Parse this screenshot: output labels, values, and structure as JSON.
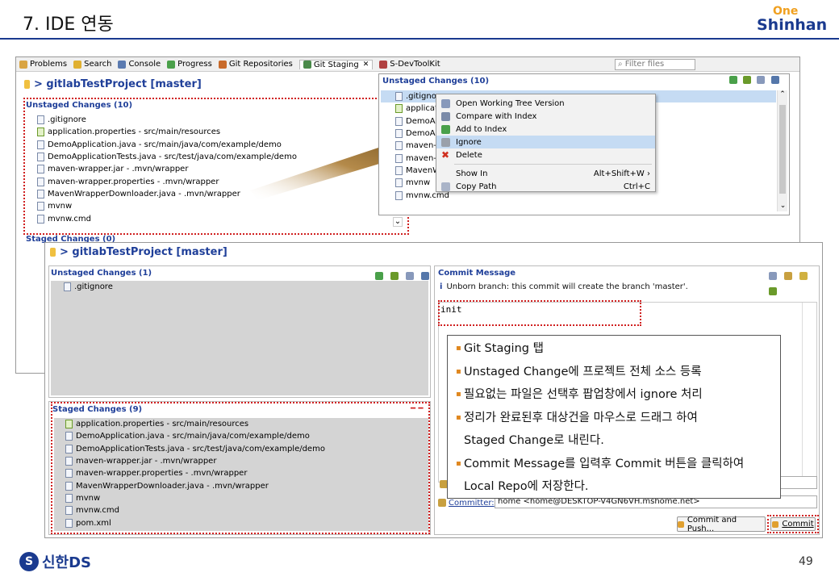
{
  "slide": {
    "title": "7. IDE 연동",
    "logo_top": "One",
    "logo_bottom": "Shinhan",
    "page_number": "49",
    "footer_brand": "신한DS",
    "footer_mark": "S"
  },
  "eclipse": {
    "tabs": [
      {
        "label": "Problems",
        "icon": "problems-icon"
      },
      {
        "label": "Search",
        "icon": "search-icon"
      },
      {
        "label": "Console",
        "icon": "console-icon"
      },
      {
        "label": "Progress",
        "icon": "progress-icon"
      },
      {
        "label": "Git Repositories",
        "icon": "git-repositories-icon"
      },
      {
        "label": "Git Staging",
        "icon": "git-staging-icon",
        "active": true
      },
      {
        "label": "S-DevToolKit",
        "icon": "devtoolkit-icon"
      }
    ],
    "filter_placeholder": "Filter files",
    "project_header": "> gitlabTestProject [master]",
    "unstaged_header": "Unstaged Changes (10)",
    "staged_header": "Staged Changes (0)",
    "unstaged_files": [
      ".gitignore",
      "application.properties - src/main/resources",
      "DemoApplication.java - src/main/java/com/example/demo",
      "DemoApplicationTests.java - src/test/java/com/example/demo",
      "maven-wrapper.jar - .mvn/wrapper",
      "maven-wrapper.properties - .mvn/wrapper",
      "MavenWrapperDownloader.java - .mvn/wrapper",
      "mvnw",
      "mvnw.cmd"
    ]
  },
  "popup_view": {
    "header": "Unstaged Changes (10)",
    "files": [
      ".gitignore",
      "applicatio",
      "DemoAp",
      "DemoAp",
      "maven-",
      "maven-w",
      "MavenW",
      "mvnw",
      "mvnw.cmd"
    ],
    "context_menu": [
      {
        "label": "Open Working Tree Version",
        "shortcut": "",
        "icon": "open-tree-icon"
      },
      {
        "label": "Compare with Index",
        "shortcut": "",
        "icon": "compare-icon"
      },
      {
        "label": "Add to Index",
        "shortcut": "",
        "icon": "add-icon"
      },
      {
        "label": "Ignore",
        "shortcut": "",
        "icon": "ignore-icon",
        "selected": true
      },
      {
        "label": "Delete",
        "shortcut": "",
        "icon": "delete-icon"
      },
      {
        "separator": true
      },
      {
        "label": "Show In",
        "shortcut": "Alt+Shift+W ›",
        "icon": ""
      },
      {
        "label": "Copy Path",
        "shortcut": "Ctrl+C",
        "icon": "copy-icon"
      }
    ]
  },
  "staging_view": {
    "project_header": "> gitlabTestProject [master]",
    "unstaged_header": "Unstaged Changes (1)",
    "unstaged_files": [
      ".gitignore"
    ],
    "staged_header": "Staged Changes (9)",
    "staged_files": [
      "application.properties - src/main/resources",
      "DemoApplication.java - src/main/java/com/example/demo",
      "DemoApplicationTests.java - src/test/java/com/example/demo",
      "maven-wrapper.jar - .mvn/wrapper",
      "maven-wrapper.properties - .mvn/wrapper",
      "MavenWrapperDownloader.java - .mvn/wrapper",
      "mvnw",
      "mvnw.cmd",
      "pom.xml"
    ],
    "commit_message_header": "Commit Message",
    "unborn_note": "Unborn branch: this commit will create the branch 'master'.",
    "commit_message": "init",
    "committer_label": "Committer:",
    "committer_value": "home <home@DESKTOP-V4GN6VH.mshome.net>",
    "commit_and_push_label": "Commit and Push...",
    "commit_label": "Commit"
  },
  "notes": [
    "Git Staging 탭",
    "Unstaged Change에 프로젝트 전체 소스 등록",
    "필요없는 파일은 선택후 팝업창에서 ignore 처리",
    "정리가 완료된후 대상건을 마우스로 드래그 하여",
    "Staged Change로 내린다.",
    "Commit Message를 입력후 Commit 버튼을 클릭하여",
    "Local Repo에 저장한다."
  ],
  "colors": {
    "accent_blue": "#1f3f99",
    "highlight_red": "#d02020",
    "bullet_orange": "#e08820",
    "selection_blue": "#c5dbf3"
  }
}
